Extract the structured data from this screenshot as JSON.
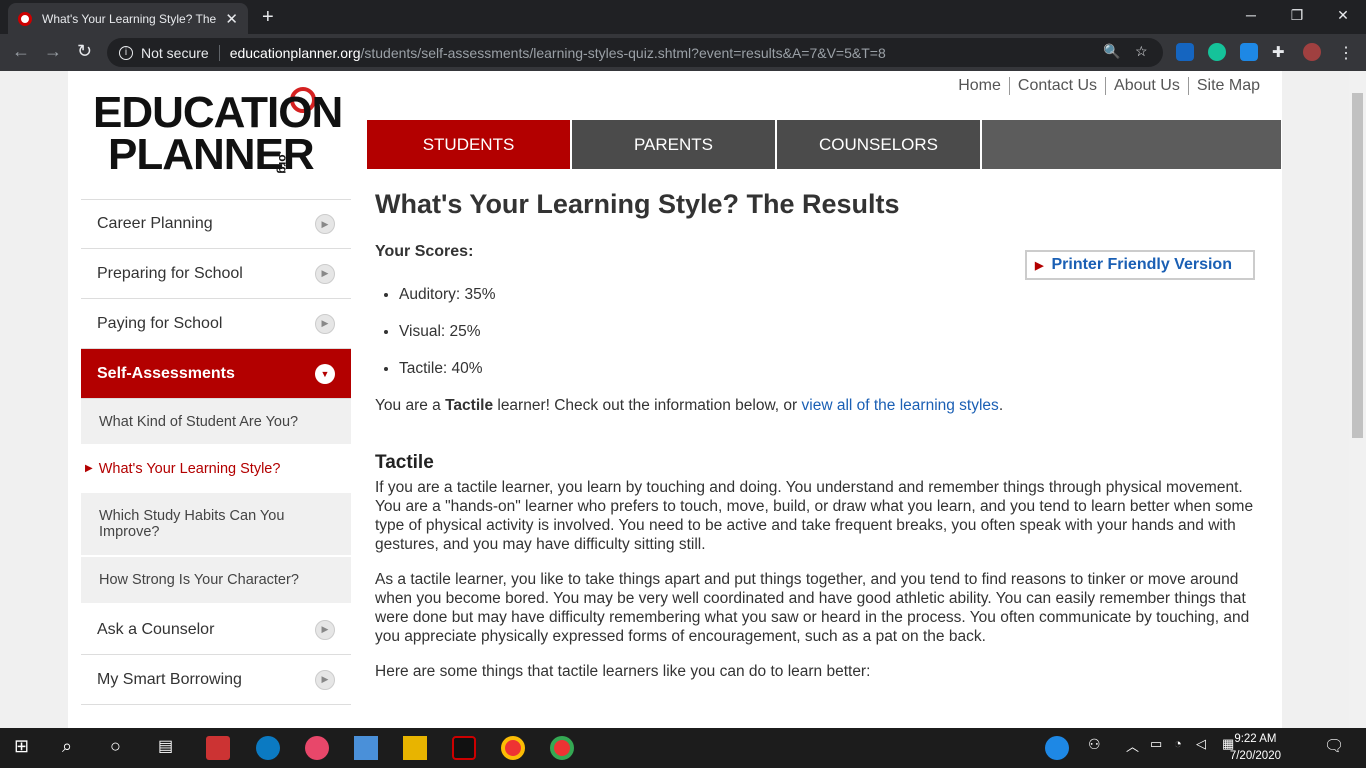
{
  "browser": {
    "tab_title": "What's Your Learning Style? The Resu",
    "new_tab": "+",
    "url_security": "Not secure",
    "url_domain": "educationplanner.org",
    "url_path": "/students/self-assessments/learning-styles-quiz.shtml?event=results&A=7&V=5&T=8"
  },
  "logo": {
    "line1": "EDUCATION",
    "line2": "PLANNER",
    "suffix": ".org"
  },
  "toplinks": [
    "Home",
    "Contact Us",
    "About Us",
    "Site Map"
  ],
  "mainnav": [
    "STUDENTS",
    "PARENTS",
    "COUNSELORS"
  ],
  "sidebar": {
    "items": [
      {
        "label": "Career Planning"
      },
      {
        "label": "Preparing for School"
      },
      {
        "label": "Paying for School"
      },
      {
        "label": "Self-Assessments"
      }
    ],
    "subitems": [
      {
        "label": "What Kind of Student Are You?"
      },
      {
        "label": "What's Your Learning Style?"
      },
      {
        "label": "Which Study Habits Can You Improve?"
      },
      {
        "label": "How Strong Is Your Character?"
      }
    ],
    "bottom_items": [
      {
        "label": "Ask a Counselor"
      },
      {
        "label": "My Smart Borrowing"
      }
    ]
  },
  "content": {
    "title": "What's Your Learning Style? The Results",
    "scores_label": "Your Scores:",
    "scores": [
      {
        "label": "Auditory: 35%"
      },
      {
        "label": "Visual: 25%"
      },
      {
        "label": "Tactile: 40%"
      }
    ],
    "printer_label": "Printer Friendly Version",
    "summary_pre": "You are a ",
    "summary_bold": "Tactile",
    "summary_mid": " learner! Check out the information below, or ",
    "summary_link": "view all of the learning styles",
    "summary_post": ".",
    "section_title": "Tactile",
    "para1": "If you are a tactile learner, you learn by touching and doing. You understand and remember things through physical movement. You are a \"hands-on\" learner who prefers to touch, move, build, or draw what you learn, and you tend to learn better when some type of physical activity is involved. You need to be active and take frequent breaks, you often speak with your hands and with gestures, and you may have difficulty sitting still.",
    "para2": "As a tactile learner, you like to take things apart and put things together, and you tend to find reasons to tinker or move around when you become bored. You may be very well coordinated and have good athletic ability. You can easily remember things that were done but may have difficulty remembering what you saw or heard in the process. You often communicate by touching, and you appreciate physically expressed forms of encouragement, such as a pat on the back.",
    "para3": "Here are some things that tactile learners like you can do to learn better:"
  },
  "taskbar": {
    "time": "9:22 AM",
    "date": "7/20/2020"
  }
}
